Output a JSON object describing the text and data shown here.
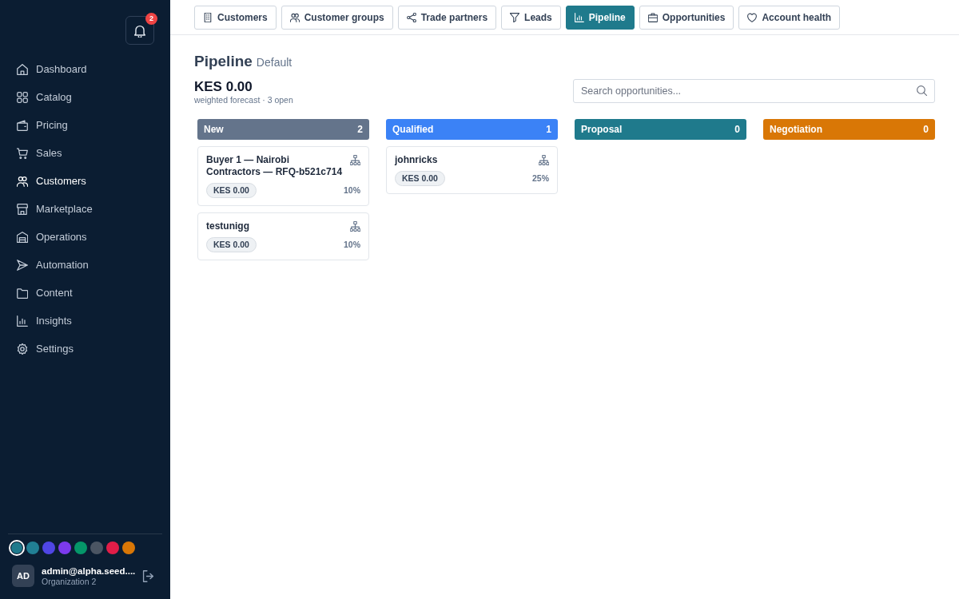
{
  "sidebar": {
    "notifications": {
      "count": "2"
    },
    "nav_items": [
      {
        "label": "Dashboard",
        "selected": false
      },
      {
        "label": "Catalog",
        "selected": false
      },
      {
        "label": "Pricing",
        "selected": false
      },
      {
        "label": "Sales",
        "selected": false
      },
      {
        "label": "Customers",
        "selected": true
      },
      {
        "label": "Marketplace",
        "selected": false
      },
      {
        "label": "Operations",
        "selected": false
      },
      {
        "label": "Automation",
        "selected": false
      },
      {
        "label": "Content",
        "selected": false
      },
      {
        "label": "Insights",
        "selected": false
      },
      {
        "label": "Settings",
        "selected": false
      }
    ],
    "theme_swatches": [
      {
        "color": "#1f7a8c",
        "selected": true
      },
      {
        "color": "#217f94",
        "selected": false
      },
      {
        "color": "#4f46e5",
        "selected": false
      },
      {
        "color": "#7c3aed",
        "selected": false
      },
      {
        "color": "#059669",
        "selected": false
      },
      {
        "color": "#4b5563",
        "selected": false
      },
      {
        "color": "#e11d48",
        "selected": false
      },
      {
        "color": "#d97706",
        "selected": false
      }
    ],
    "user": {
      "initials": "AD",
      "name": "admin@alpha.seed....",
      "organization": "Organization 2"
    }
  },
  "tabs": [
    {
      "label": "Customers",
      "selected": false
    },
    {
      "label": "Customer groups",
      "selected": false
    },
    {
      "label": "Trade partners",
      "selected": false
    },
    {
      "label": "Leads",
      "selected": false
    },
    {
      "label": "Pipeline",
      "selected": true
    },
    {
      "label": "Opportunities",
      "selected": false
    },
    {
      "label": "Account health",
      "selected": false
    }
  ],
  "header": {
    "title": "Pipeline",
    "subtitle": "Default"
  },
  "forecast": {
    "amount": "KES 0.00",
    "caption": "weighted forecast · 3 open"
  },
  "search": {
    "placeholder": "Search opportunities..."
  },
  "columns": [
    {
      "title": "New",
      "count": "2",
      "color": "#64748b",
      "cards": [
        {
          "title": "Buyer 1 — Nairobi Contractors — RFQ-b521c714",
          "amount": "KES 0.00",
          "probability": "10%"
        },
        {
          "title": "testunigg",
          "amount": "KES 0.00",
          "probability": "10%"
        }
      ]
    },
    {
      "title": "Qualified",
      "count": "1",
      "color": "#3b82f6",
      "cards": [
        {
          "title": "johnricks",
          "amount": "KES 0.00",
          "probability": "25%"
        }
      ]
    },
    {
      "title": "Proposal",
      "count": "0",
      "color": "#1f7a8c"
    },
    {
      "title": "Negotiation",
      "count": "0",
      "color": "#d97706"
    }
  ]
}
